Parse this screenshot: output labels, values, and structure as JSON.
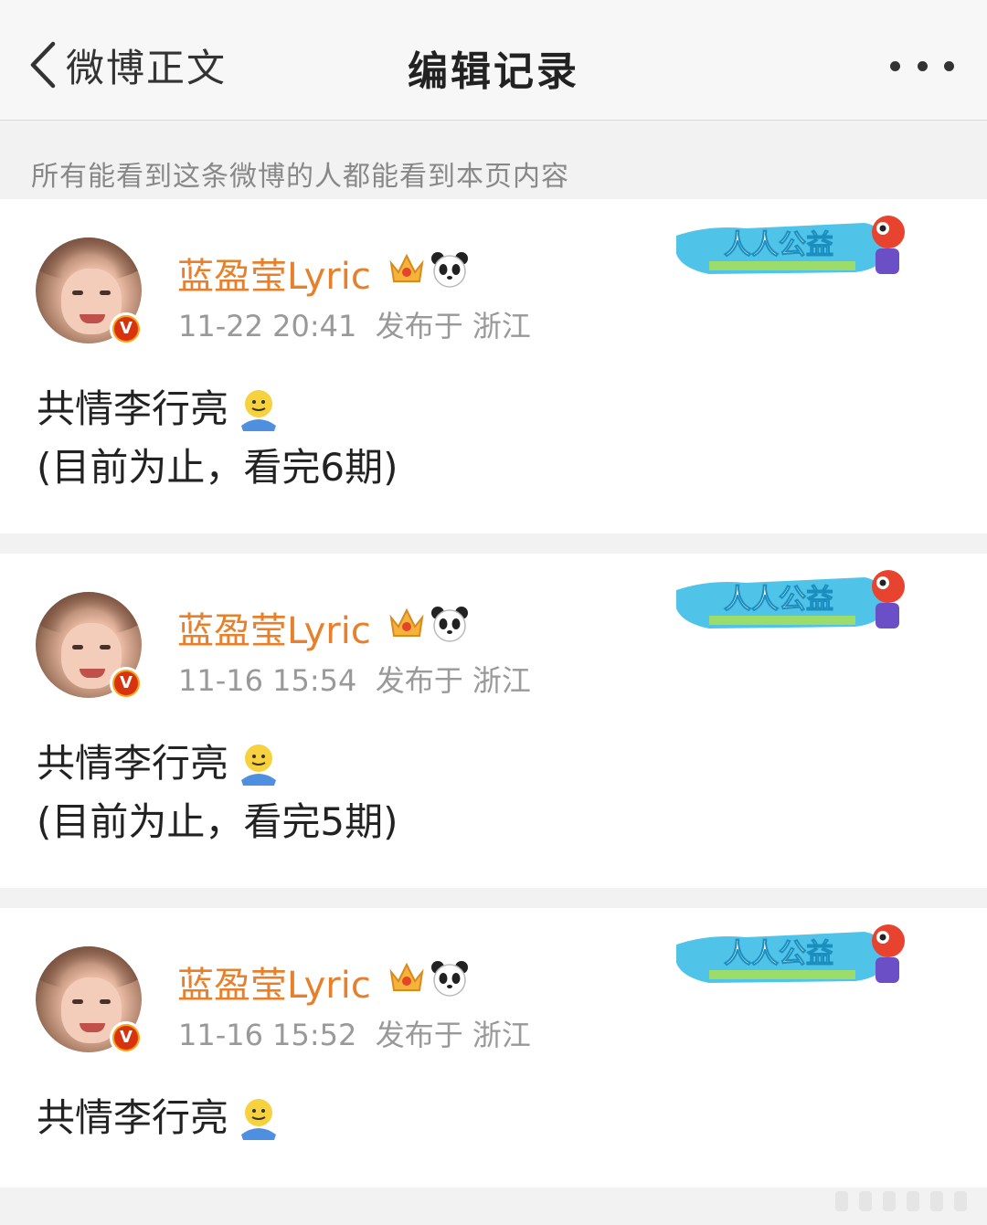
{
  "nav": {
    "back_label": "微博正文",
    "title": "编辑记录",
    "back_icon": "chevron-left-icon",
    "more_icon": "more-dots-icon"
  },
  "notice": "所有能看到这条微博的人都能看到本页内容",
  "posts": [
    {
      "username": "蓝盈莹Lyric",
      "time": "11-22 20:41",
      "location": "发布于 浙江",
      "lines": [
        "共情李行亮",
        "(目前为止，看完6期)"
      ],
      "banner": "人人公益"
    },
    {
      "username": "蓝盈莹Lyric",
      "time": "11-16 15:54",
      "location": "发布于 浙江",
      "lines": [
        "共情李行亮",
        "(目前为止，看完5期)"
      ],
      "banner": "人人公益"
    },
    {
      "username": "蓝盈莹Lyric",
      "time": "11-16 15:52",
      "location": "发布于 浙江",
      "lines": [
        "共情李行亮"
      ],
      "banner": "人人公益"
    }
  ],
  "verified_badge": "V",
  "colors": {
    "username": "#e8802b",
    "meta": "#999999",
    "background": "#f2f2f2",
    "verified": "#d9320f"
  }
}
